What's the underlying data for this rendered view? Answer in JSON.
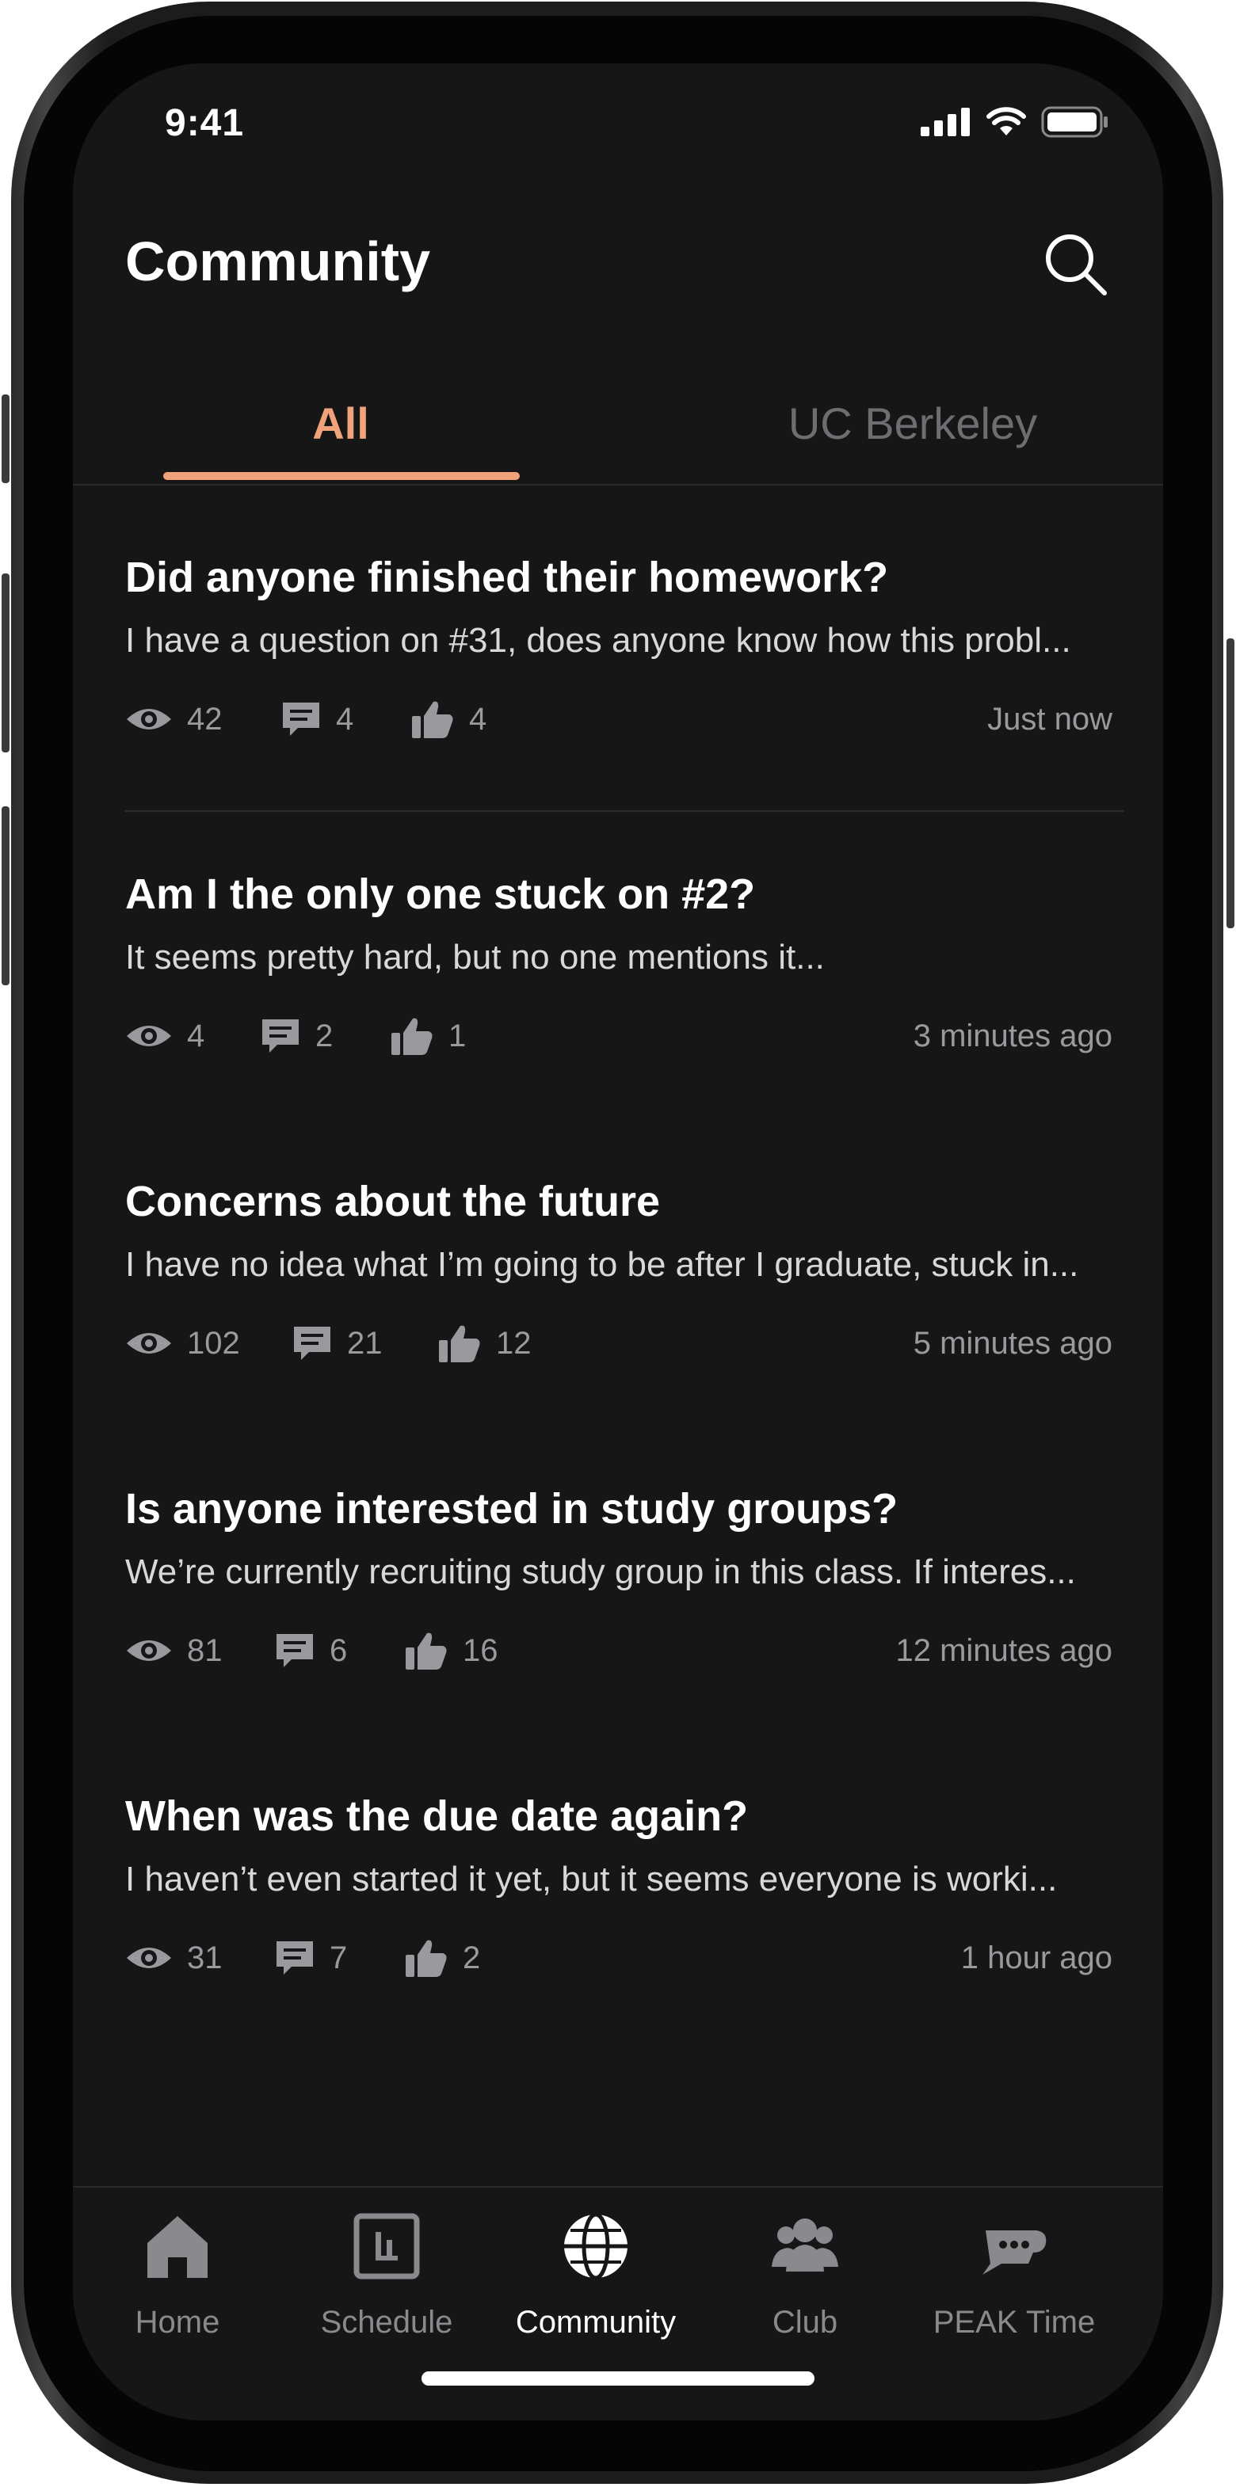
{
  "status_bar": {
    "time": "9:41"
  },
  "header": {
    "title": "Community"
  },
  "tabs": [
    {
      "label": "All",
      "active": true
    },
    {
      "label": "UC Berkeley",
      "active": false
    }
  ],
  "posts": [
    {
      "title": "Did anyone finished their homework?",
      "body": "I have a question on #31, does anyone know how this probl...",
      "views": "42",
      "comments": "4",
      "likes": "4",
      "time": "Just now"
    },
    {
      "title": "Am I the only one stuck on #2?",
      "body": "It seems pretty hard, but no one mentions it...",
      "views": "4",
      "comments": "2",
      "likes": "1",
      "time": "3 minutes ago"
    },
    {
      "title": "Concerns about the future",
      "body": "I have no idea what I’m going to be after I graduate, stuck in...",
      "views": "102",
      "comments": "21",
      "likes": "12",
      "time": "5 minutes ago"
    },
    {
      "title": "Is anyone interested in study groups?",
      "body": "We’re currently recruiting study group in this class. If interes...",
      "views": "81",
      "comments": "6",
      "likes": "16",
      "time": "12 minutes ago"
    },
    {
      "title": "When was the due date again?",
      "body": "I haven’t even started it yet, but it seems everyone is worki...",
      "views": "31",
      "comments": "7",
      "likes": "2",
      "time": "1 hour ago"
    }
  ],
  "nav": [
    {
      "label": "Home",
      "icon": "home-icon"
    },
    {
      "label": "Schedule",
      "icon": "schedule-icon"
    },
    {
      "label": "Community",
      "icon": "globe-icon",
      "active": true
    },
    {
      "label": "Club",
      "icon": "group-icon"
    },
    {
      "label": "PEAK Time",
      "icon": "coffee-chat-icon"
    }
  ],
  "colors": {
    "accent": "#f0a27a",
    "background": "#161617",
    "muted": "#9a9a9e"
  }
}
